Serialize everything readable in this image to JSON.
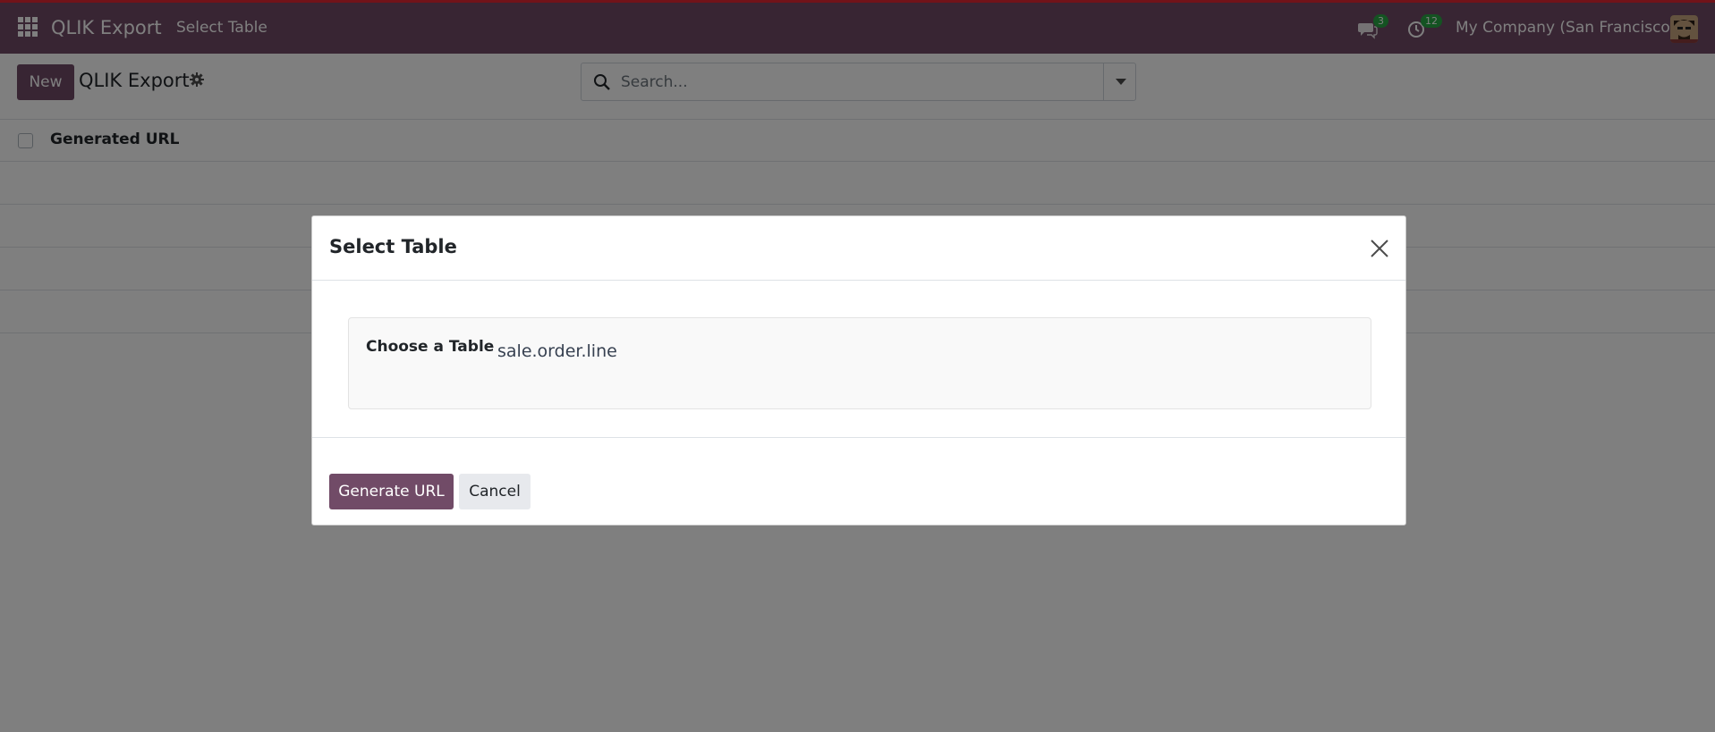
{
  "navbar": {
    "brand": "QLIK Export",
    "menu_item": "Select Table",
    "messages_count": "3",
    "activities_count": "12",
    "company": "My Company (San Francisco)"
  },
  "control_panel": {
    "new_label": "New",
    "title": "QLIK Export",
    "search_placeholder": "Search..."
  },
  "list": {
    "columns": [
      "Generated URL"
    ]
  },
  "modal": {
    "title": "Select Table",
    "field_label": "Choose a Table",
    "field_value": "sale.order.line",
    "primary_label": "Generate URL",
    "secondary_label": "Cancel"
  },
  "colors": {
    "brand": "#714b67",
    "accent_top": "#e32633",
    "badge": "#28a745"
  },
  "icons": [
    "apps-grid-icon",
    "chat-icon",
    "clock-icon",
    "avatar",
    "gear-icon",
    "search-icon",
    "caret-down-icon",
    "close-icon"
  ]
}
